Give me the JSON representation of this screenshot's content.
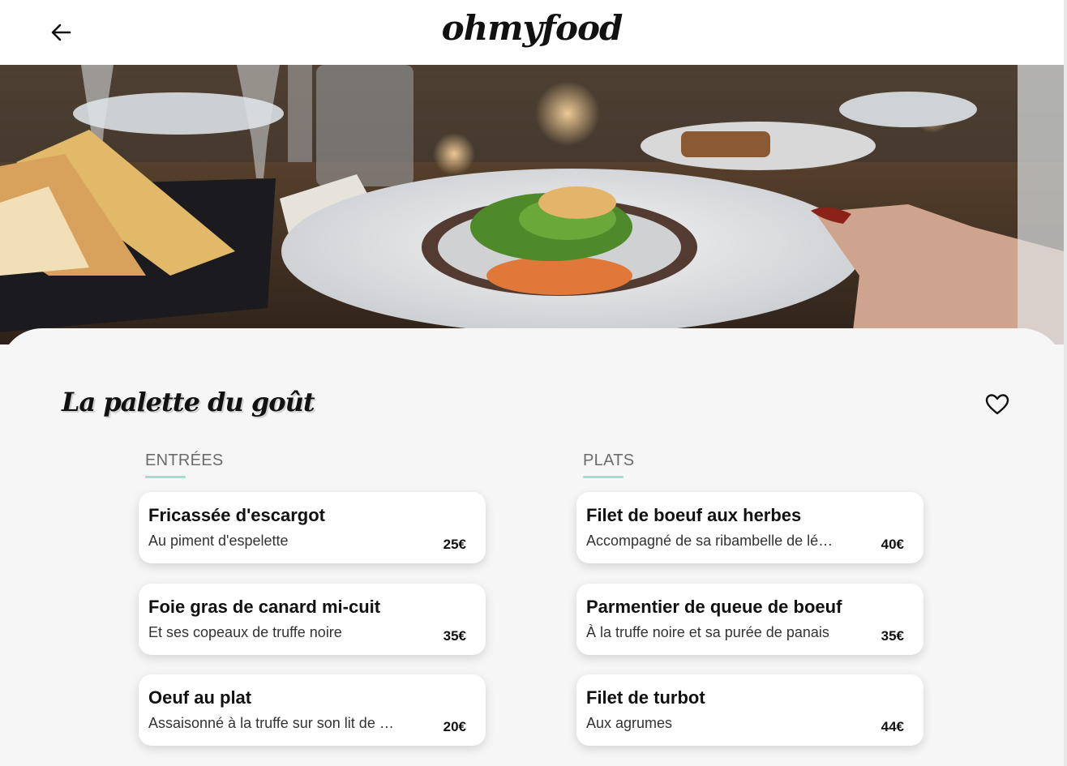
{
  "header": {
    "logo": "ohmyfood",
    "back_icon": "arrow-left-icon"
  },
  "restaurant": {
    "name": "La palette du goût",
    "favorite_icon": "heart-outline-icon"
  },
  "menu": {
    "entrees": {
      "title": "ENTRÉES",
      "items": [
        {
          "name": "Fricassée d'escargot",
          "description": "Au piment d'espelette",
          "price": "25€"
        },
        {
          "name": "Foie gras de canard mi-cuit",
          "description": "Et ses copeaux de truffe noire",
          "price": "35€"
        },
        {
          "name": "Oeuf au plat",
          "description": "Assaisonné à la truffe sur son lit de …",
          "price": "20€"
        }
      ]
    },
    "plats": {
      "title": "PLATS",
      "items": [
        {
          "name": "Filet de boeuf aux herbes",
          "description": "Accompagné de sa ribambelle de lé…",
          "price": "40€"
        },
        {
          "name": "Parmentier de queue de boeuf",
          "description": "À la truffe noire et sa purée de panais",
          "price": "35€"
        },
        {
          "name": "Filet de turbot",
          "description": "Aux agrumes",
          "price": "44€"
        }
      ]
    }
  },
  "colors": {
    "accent": "#99e2d0",
    "background": "#f6f6f6",
    "card": "#ffffff"
  }
}
